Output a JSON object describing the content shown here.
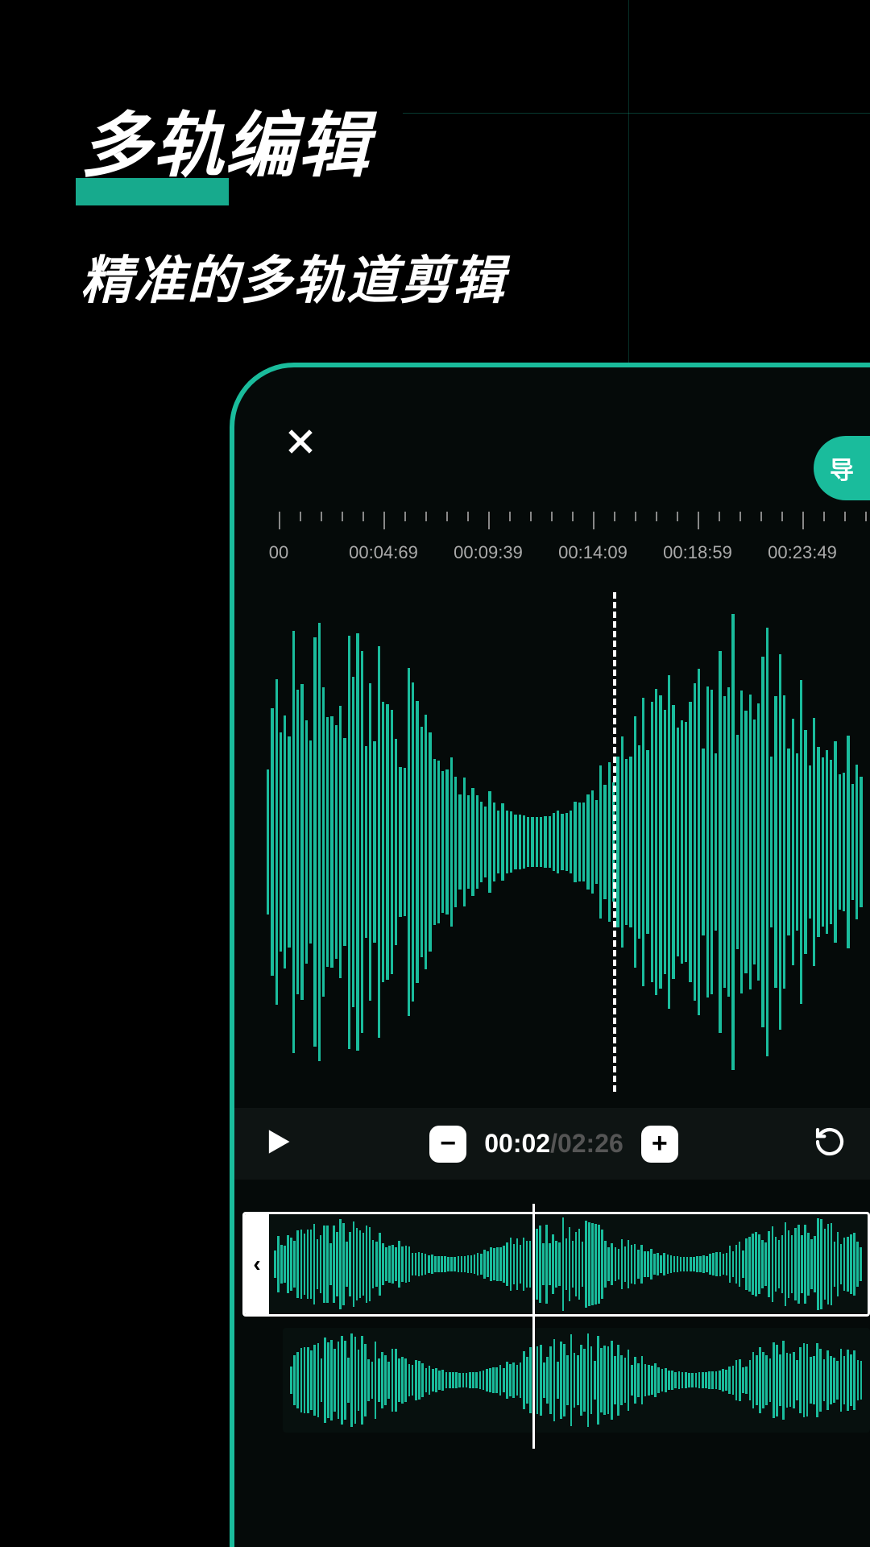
{
  "heading": {
    "main": "多轨编辑",
    "sub": "精准的多轨道剪辑"
  },
  "export_label": "导",
  "ruler_labels": [
    "00",
    "00:04:69",
    "00:09:39",
    "00:14:09",
    "00:18:59",
    "00:23:49"
  ],
  "time": {
    "current": "00:02",
    "separator": "/",
    "total": "02:26"
  },
  "icons": {
    "close": "close-icon",
    "play": "play-icon",
    "minus": "−",
    "plus": "+",
    "reset": "reset-icon",
    "handle_left": "‹"
  }
}
